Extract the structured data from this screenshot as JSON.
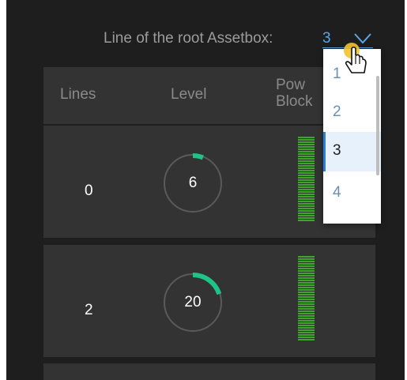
{
  "selector": {
    "label": "Line of the root Assetbox:",
    "value": "3",
    "options": [
      "1",
      "2",
      "3",
      "4"
    ],
    "selected_index": 2
  },
  "table": {
    "headers": {
      "lines": "Lines",
      "level": "Level",
      "power_line1": "Pow",
      "power_line2": "Block"
    },
    "rows": [
      {
        "lines": "0",
        "level": "6",
        "level_progress": 0.06
      },
      {
        "lines": "2",
        "level": "20",
        "level_progress": 0.2
      }
    ]
  },
  "colors": {
    "panel_bg": "#1e1e1e",
    "row_bg": "#333333",
    "accent_blue": "#5aa6e6",
    "ring_green": "#1ec38a",
    "bar_green": "#3fa52a",
    "ring_track": "#5a5a5a"
  },
  "icons": {
    "chevron": "chevron-down-icon",
    "cursor": "hand-pointer-icon"
  }
}
